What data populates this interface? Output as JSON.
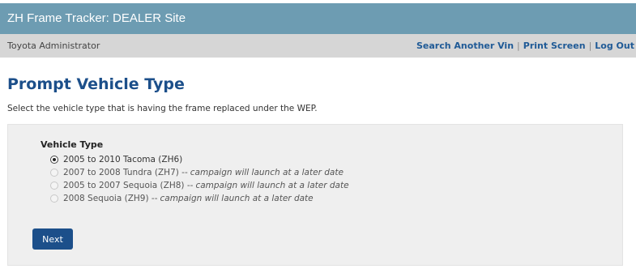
{
  "header": {
    "app_title": "ZH Frame Tracker: DEALER Site"
  },
  "userbar": {
    "user_name": "Toyota Administrator",
    "links": {
      "search_vin": "Search Another Vin",
      "separator": "|",
      "print_screen": "Print Screen",
      "log_out": "Log Out"
    }
  },
  "main": {
    "title": "Prompt Vehicle Type",
    "instruction": "Select the vehicle type that is having the frame replaced under the WEP.",
    "form": {
      "group_label": "Vehicle Type",
      "options": [
        {
          "label": "2005 to 2010 Tacoma (ZH6)",
          "note": "",
          "checked": true,
          "disabled": false
        },
        {
          "label": "2007 to 2008 Tundra (ZH7) --",
          "note": "campaign will launch at a later date",
          "checked": false,
          "disabled": true
        },
        {
          "label": "2005 to 2007 Sequoia (ZH8) --",
          "note": "campaign will launch at a later date",
          "checked": false,
          "disabled": true
        },
        {
          "label": "2008 Sequoia (ZH9) --",
          "note": "campaign will launch at a later date",
          "checked": false,
          "disabled": true
        }
      ],
      "next_label": "Next"
    }
  }
}
